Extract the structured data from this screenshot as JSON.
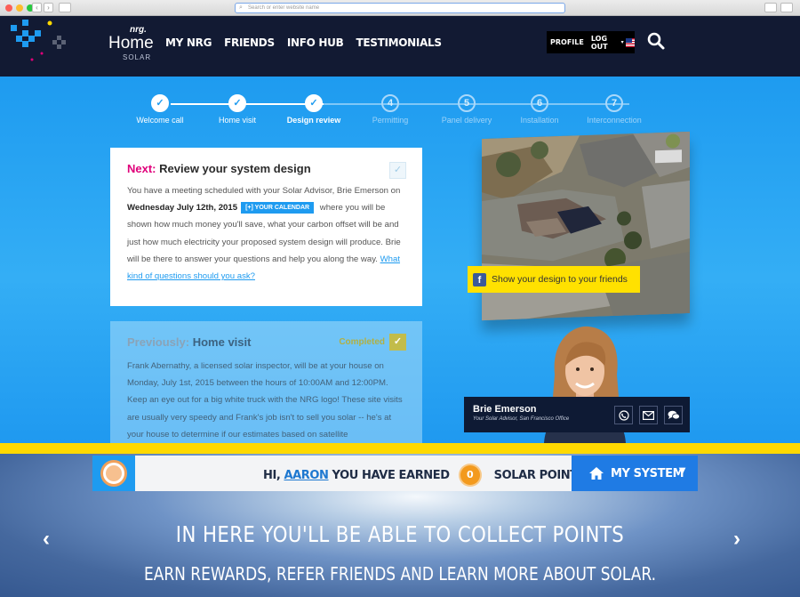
{
  "browser": {
    "url_placeholder": "Search or enter website name"
  },
  "header": {
    "brand_nrg": "nrg.",
    "brand_home": "Home",
    "brand_solar": "SOLAR",
    "nav": [
      "MY NRG",
      "FRIENDS",
      "INFO HUB",
      "TESTIMONIALS"
    ],
    "profile_label": "PROFILE",
    "logout_label": "LOG OUT",
    "icons": [
      "nrg-plus-logo-icon",
      "us-flag-icon",
      "search-icon"
    ]
  },
  "steps": [
    {
      "label": "Welcome call",
      "status": "done",
      "marker": "✓"
    },
    {
      "label": "Home visit",
      "status": "done",
      "marker": "✓"
    },
    {
      "label": "Design review",
      "status": "current",
      "marker": "✓"
    },
    {
      "label": "Permitting",
      "status": "todo",
      "marker": "4"
    },
    {
      "label": "Panel delivery",
      "status": "todo",
      "marker": "5"
    },
    {
      "label": "Installation",
      "status": "todo",
      "marker": "6"
    },
    {
      "label": "Interconnection",
      "status": "todo",
      "marker": "7"
    }
  ],
  "next_card": {
    "prefix": "Next:",
    "title": "Review your system design",
    "text_1": "You have a meeting scheduled with your Solar Advisor, Brie Emerson on ",
    "date": "Wednesday July 12th, 2015",
    "calendar_button": "[+] YOUR CALENDAR",
    "text_2": " where you will be shown how much money you'll save, what your carbon offset will be and just how much electricity your proposed system design will produce. Brie will be there to answer your questions and help you along the way. ",
    "link": "What kind of questions should you ask?"
  },
  "prev_card": {
    "prefix": "Previously:",
    "title": "Home visit",
    "status": "Completed",
    "text": "Frank Abernathy, a licensed solar inspector, will be at your house on Monday, July 1st, 2015 between the hours of 10:00AM and 12:00PM. Keep an eye out for a big white truck with the NRG logo! These site visits are usually very speedy and Frank's job isn't to sell you solar -- he's at your house to determine if our estimates based on satellite"
  },
  "share": {
    "label": "Show your design to your friends",
    "icon": "facebook-icon"
  },
  "advisor": {
    "name": "Brie Emerson",
    "role": "Your Solar Advisor, San Francisco Office",
    "actions": [
      "phone-icon",
      "email-icon",
      "chat-icon"
    ]
  },
  "points": {
    "greeting": "HI,",
    "user": "AARON",
    "earned": "YOU HAVE EARNED",
    "value": "0",
    "unit": "SOLAR POINTS",
    "my_system": "MY SYSTEM"
  },
  "promo": {
    "line1": "IN HERE YOU'LL BE ABLE TO COLLECT POINTS",
    "line2": "EARN REWARDS, REFER FRIENDS AND LEARN MORE ABOUT SOLAR.",
    "prev": "‹",
    "next": "›"
  },
  "colors": {
    "brand_blue": "#1e9bf0",
    "navy": "#121a33",
    "accent_pink": "#e0007a",
    "yellow": "#ffd900",
    "completed_olive": "#c2bc4a",
    "points_orange": "#f39a1e"
  }
}
